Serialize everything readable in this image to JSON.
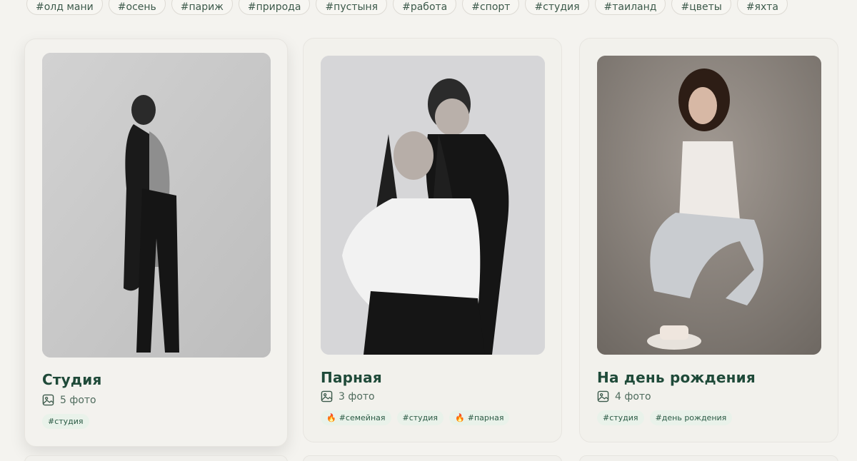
{
  "tagbar": {
    "items": [
      "#олд мани",
      "#осень",
      "#париж",
      "#природа",
      "#пустыня",
      "#работа",
      "#спорт",
      "#студия",
      "#таиланд",
      "#цветы",
      "#яхта"
    ]
  },
  "cards": [
    {
      "title": "Студия",
      "photo_count": "5 фото",
      "photo_icon": "image-icon",
      "tags": [
        {
          "label": "#студия",
          "hot": false
        }
      ]
    },
    {
      "title": "Парная",
      "photo_count": "3 фото",
      "photo_icon": "image-icon",
      "tags": [
        {
          "label": "#семейная",
          "hot": true
        },
        {
          "label": "#студия",
          "hot": false
        },
        {
          "label": "#парная",
          "hot": true
        }
      ]
    },
    {
      "title": "На день рождения",
      "photo_count": "4 фото",
      "photo_icon": "image-icon",
      "tags": [
        {
          "label": "#студия",
          "hot": false
        },
        {
          "label": "#день рождения",
          "hot": false
        }
      ]
    }
  ],
  "icons": {
    "fire": "🔥"
  },
  "colors": {
    "background": "#f4f3ef",
    "title": "#1f4a39",
    "tag_bg": "#e9f2ea",
    "tag_text": "#2a5a44"
  }
}
